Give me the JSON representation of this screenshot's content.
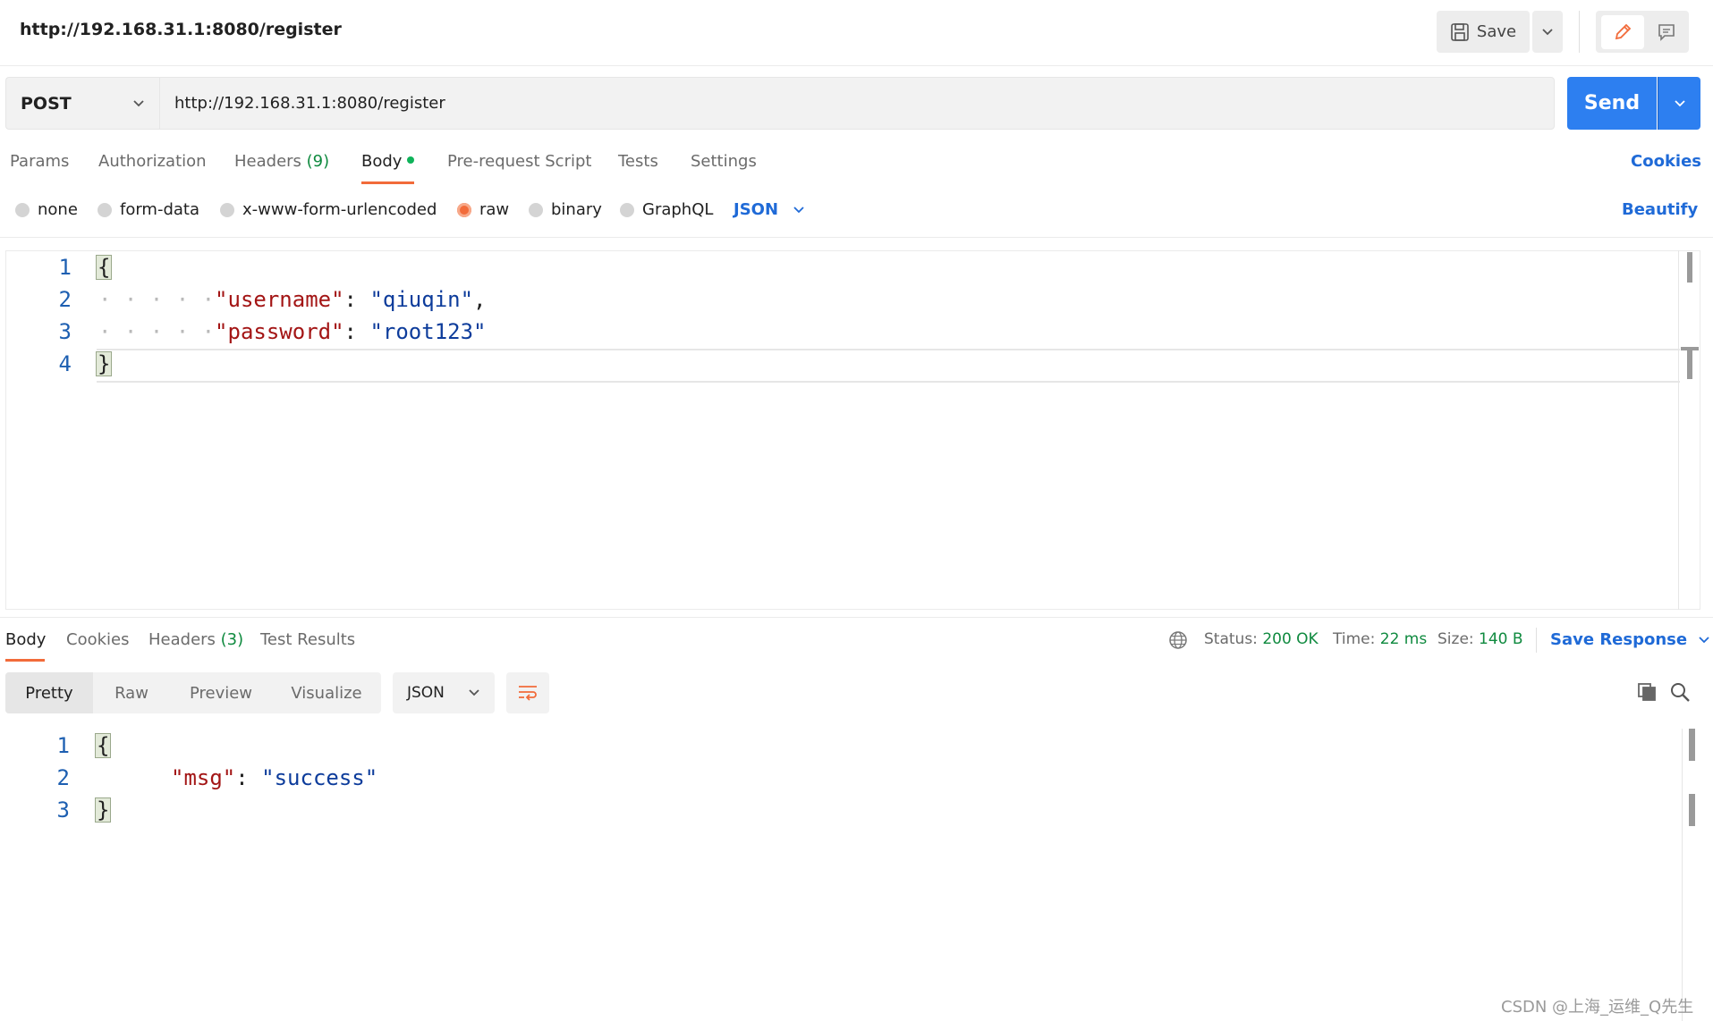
{
  "request": {
    "title": "http://192.168.31.1:8080/register",
    "save_label": "Save",
    "method": "POST",
    "url": "http://192.168.31.1:8080/register",
    "send_label": "Send"
  },
  "request_tabs": {
    "params": "Params",
    "authorization": "Authorization",
    "headers": "Headers",
    "headers_count": "(9)",
    "body": "Body",
    "pre_request": "Pre-request Script",
    "tests": "Tests",
    "settings": "Settings",
    "cookies": "Cookies"
  },
  "body_types": {
    "none": "none",
    "form_data": "form-data",
    "urlencoded": "x-www-form-urlencoded",
    "raw": "raw",
    "binary": "binary",
    "graphql": "GraphQL",
    "format": "JSON",
    "beautify": "Beautify",
    "selected": "raw"
  },
  "request_body": {
    "line_numbers": [
      "1",
      "2",
      "3",
      "4"
    ],
    "open_brace": "{",
    "close_brace": "}",
    "indent_dots": "· · · · ·",
    "username_key": "\"username\"",
    "username_value": "\"qiuqin\"",
    "password_key": "\"password\"",
    "password_value": "\"root123\"",
    "colon": ":",
    "comma": ","
  },
  "response_tabs": {
    "body": "Body",
    "cookies": "Cookies",
    "headers": "Headers",
    "headers_count": "(3)",
    "test_results": "Test Results"
  },
  "response_status": {
    "status_label": "Status:",
    "status_value": "200 OK",
    "time_label": "Time:",
    "time_value": "22 ms",
    "size_label": "Size:",
    "size_value": "140 B",
    "save_response": "Save Response"
  },
  "response_view": {
    "pretty": "Pretty",
    "raw": "Raw",
    "preview": "Preview",
    "visualize": "Visualize",
    "format": "JSON"
  },
  "response_body": {
    "line_numbers": [
      "1",
      "2",
      "3"
    ],
    "open_brace": "{",
    "close_brace": "}",
    "msg_key": "\"msg\"",
    "msg_value": "\"success\"",
    "colon": ":"
  },
  "watermark": "CSDN @上海_运维_Q先生",
  "colors": {
    "accent_blue": "#2d7ff0",
    "link_blue": "#1f6ad7",
    "accent_orange": "#f26b3a",
    "success_green": "#0f8a3f"
  }
}
